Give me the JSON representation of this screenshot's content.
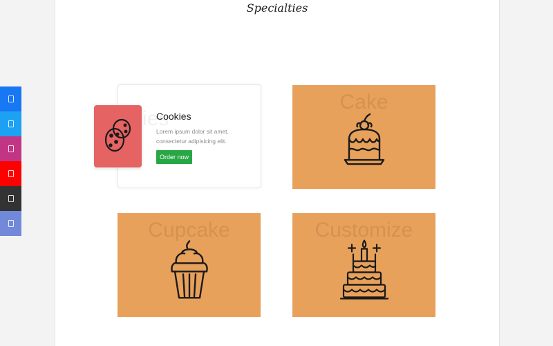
{
  "section": {
    "title": "Specialties"
  },
  "social": [
    {
      "name": "facebook-icon",
      "color": "#1877f2"
    },
    {
      "name": "twitter-icon",
      "color": "#1da1f2"
    },
    {
      "name": "instagram-icon",
      "color": "#c13584"
    },
    {
      "name": "youtube-icon",
      "color": "#ff0000"
    },
    {
      "name": "github-icon",
      "color": "#333333"
    },
    {
      "name": "discord-icon",
      "color": "#7289da"
    }
  ],
  "cards": {
    "cookies": {
      "ghost_label": "Cookies",
      "title": "Cookies",
      "description": "Lorem ipsum dolor sit amet, consectetur adipisicing elit.",
      "button_label": "Order now",
      "icon": "cookie-icon",
      "icon_bg": "#e56363",
      "button_color": "#28a745"
    },
    "cake": {
      "ghost_label": "Cake",
      "icon": "cake-icon"
    },
    "cupcake": {
      "ghost_label": "Cupcake",
      "icon": "cupcake-icon"
    },
    "customize": {
      "ghost_label": "Customize",
      "icon": "birthday-cake-icon"
    }
  },
  "colors": {
    "tile_bg": "#e8a15a",
    "page_bg": "#f3f3f3"
  }
}
